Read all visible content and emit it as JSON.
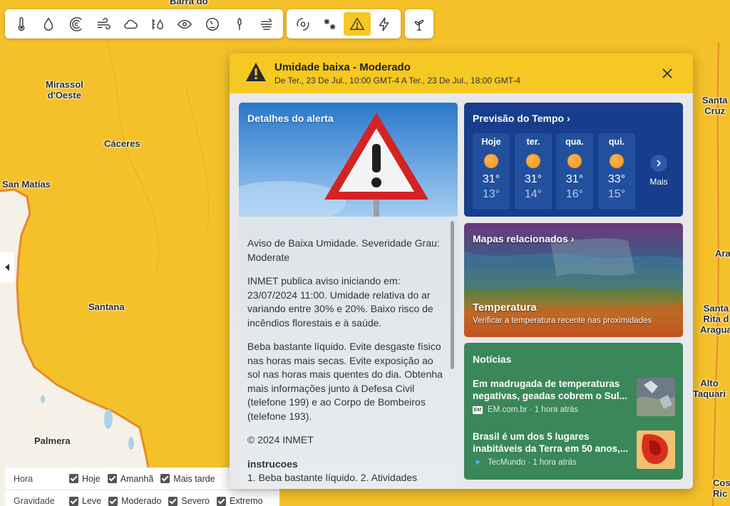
{
  "toolbar": {
    "main_tools": [
      "thermometer-icon",
      "droplet-icon",
      "wind-swirl-icon",
      "wind-icon",
      "cloud-icon",
      "rain-gauge-icon",
      "eye-icon",
      "pressure-gauge-icon",
      "pollen-icon",
      "fog-icon"
    ],
    "alert_tools": [
      "hurricane-icon",
      "snow-icon",
      "warning-icon",
      "lightning-icon"
    ],
    "active_tool": "warning-icon",
    "extra_tool": "plant-icon"
  },
  "map": {
    "cities": [
      {
        "id": "barra",
        "name": "Barra do"
      },
      {
        "id": "mirassol",
        "name": "Mirassol\nd'Oeste"
      },
      {
        "id": "caceres",
        "name": "Cáceres"
      },
      {
        "id": "san-matias",
        "name": "San Matías"
      },
      {
        "id": "santana",
        "name": "Santana"
      },
      {
        "id": "palmera",
        "name": "Palmera"
      },
      {
        "id": "santa-cruz",
        "name": "Santa\nCruz"
      },
      {
        "id": "ara",
        "name": "Ara"
      },
      {
        "id": "santa-rita",
        "name": "Santa\nRita d\nAragua"
      },
      {
        "id": "alto-taquari",
        "name": "Alto\nTaquari"
      },
      {
        "id": "cos",
        "name": "Cos\nRic"
      }
    ]
  },
  "filters": {
    "hora": {
      "label": "Hora",
      "options": [
        "Hoje",
        "Amanhã",
        "Mais tarde"
      ]
    },
    "gravidade": {
      "label": "Gravidade",
      "options": [
        "Leve",
        "Moderado",
        "Severo",
        "Extremo"
      ]
    }
  },
  "alert": {
    "title": "Umidade baixa - Moderado",
    "period": "De Ter., 23 De Jul., 10:00 GMT-4 A Ter., 23 De Jul., 18:00 GMT-4",
    "accent": "#f5c823",
    "details_title": "Detalhes do alerta",
    "paragraphs": [
      "Aviso de Baixa Umidade. Severidade Grau: Moderate",
      "INMET publica aviso iniciando em: 23/07/2024 11:00. Umidade relativa do ar variando entre 30% e 20%. Baixo risco de incêndios florestais e à saúde.",
      "Beba bastante líquido. Evite desgaste físico nas horas mais secas. Evite exposição ao sol nas horas mais quentes do dia. Obtenha mais informações junto à Defesa Civil (telefone 199) e ao Corpo de Bombeiros (telefone 193).",
      "© 2024 INMET"
    ],
    "instructions_title": "instrucoes",
    "instructions_text": "1. Beba bastante líquido. 2. Atividades"
  },
  "forecast": {
    "title": "Previsão do Tempo",
    "days": [
      {
        "name": "Hoje",
        "high": "31°",
        "low": "13°"
      },
      {
        "name": "ter.",
        "high": "31°",
        "low": "14°"
      },
      {
        "name": "qua.",
        "high": "31°",
        "low": "16°"
      },
      {
        "name": "qui.",
        "high": "33°",
        "low": "15°"
      }
    ],
    "more_label": "Mais"
  },
  "related_maps": {
    "title": "Mapas relacionados",
    "map_title": "Temperatura",
    "map_desc": "Verificar a temperatura recente nas proximidades"
  },
  "news": {
    "title": "Notícias",
    "items": [
      {
        "headline": "Em madrugada de temperaturas negativas, geadas cobrem o Sul...",
        "source": "EM.com.br",
        "time": "1 hora atrás"
      },
      {
        "headline": "Brasil é um dos 5 lugares inabitáveis da Terra em 50 anos,...",
        "source": "TecMundo",
        "time": "1 hora atrás"
      }
    ]
  }
}
